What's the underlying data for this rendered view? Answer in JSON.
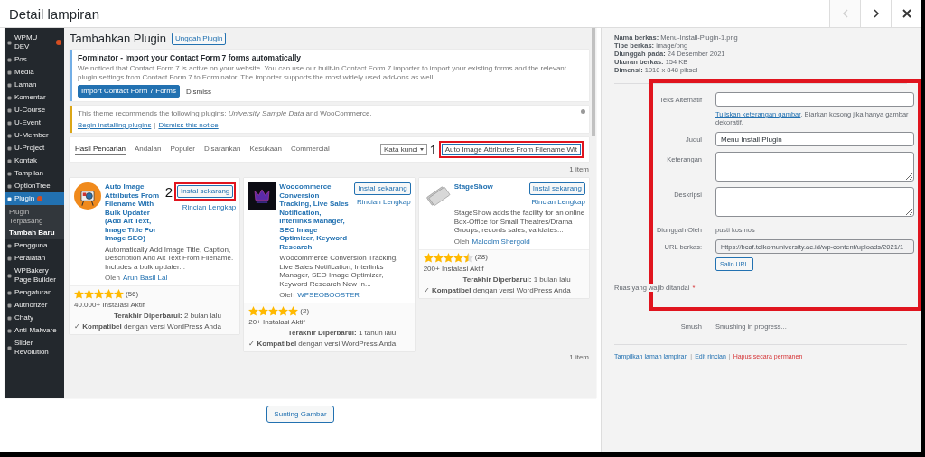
{
  "modal": {
    "title": "Detail lampiran",
    "nav": [
      {
        "kind": "prev",
        "disabled": true
      },
      {
        "kind": "next",
        "disabled": false
      },
      {
        "kind": "close",
        "disabled": false
      }
    ]
  },
  "preview": {
    "sidebar": [
      {
        "label": "WPMU DEV",
        "selected": false,
        "badge": true
      },
      {
        "label": "Pos",
        "selected": false
      },
      {
        "label": "Media",
        "selected": false
      },
      {
        "label": "Laman",
        "selected": false
      },
      {
        "label": "Komentar",
        "selected": false
      },
      {
        "label": "U-Course",
        "selected": false
      },
      {
        "label": "U-Event",
        "selected": false
      },
      {
        "label": "U-Member",
        "selected": false
      },
      {
        "label": "U-Project",
        "selected": false
      },
      {
        "label": "Kontak",
        "selected": false
      },
      {
        "label": "Tampilan",
        "selected": false
      },
      {
        "label": "OptionTree",
        "selected": false
      },
      {
        "label": "Plugin",
        "selected": true,
        "badge": true,
        "children": [
          {
            "label": "Plugin Terpasang",
            "selected": false
          },
          {
            "label": "Tambah Baru",
            "selected": true
          }
        ]
      },
      {
        "label": "Pengguna",
        "selected": false
      },
      {
        "label": "Peralatan",
        "selected": false
      },
      {
        "label": "WPBakery Page Builder",
        "selected": false
      },
      {
        "label": "Pengaturan",
        "selected": false
      },
      {
        "label": "Authorizer",
        "selected": false
      },
      {
        "label": "Chaty",
        "selected": false
      },
      {
        "label": "Anti-Malware",
        "selected": false
      },
      {
        "label": "Slider Revolution",
        "selected": false
      }
    ],
    "heading": "Tambahkan Plugin",
    "upload_button": "Unggah Plugin",
    "notices": [
      {
        "kind": "info",
        "title": "Forminator - Import your Contact Form 7 forms automatically",
        "text": "We noticed that Contact Form 7 is active on your website. You can use our built-in Contact Form 7 importer to import your existing forms and the relevant plugin settings from Contact Form 7 to Forminator. The importer supports the most widely used add-ons as well.",
        "button": "Import Contact Form 7 Forms",
        "dismiss": "Dismiss"
      },
      {
        "kind": "warning",
        "text": "This theme recommends the following plugins: *University Sample Data* and WooCommerce.",
        "links": [
          "Begin installing plugins",
          "Dismiss this notice"
        ],
        "separator": "|"
      }
    ],
    "tabs": [
      {
        "label": "Hasil Pencarian",
        "selected": true
      },
      {
        "label": "Andalan",
        "selected": false
      },
      {
        "label": "Populer",
        "selected": false
      },
      {
        "label": "Disarankan",
        "selected": false
      },
      {
        "label": "Kesukaan",
        "selected": false
      },
      {
        "label": "Commercial",
        "selected": false
      }
    ],
    "search": {
      "select": "Kata kunci",
      "value": "Auto Image Attributes From Filename Wit",
      "annotation": "1"
    },
    "result_count": "1 item",
    "cards": [
      {
        "kind": "camera",
        "title": "Auto Image Attributes From Filename With Bulk Updater (Add Alt Text, Image Title For Image SEO)",
        "description": "Automatically Add Image Title, Caption, Description And Alt Text From Filename. Includes a bulk updater...",
        "by": "Oleh",
        "author": "Arun Basil Lal",
        "install": "Instal sekarang",
        "details": "Rincian Lengkap",
        "annotation": "2",
        "stars": 5,
        "ratings": "(56)",
        "installs": "40.000+ Instalasi Aktif",
        "updated": "**Terakhir Diperbarui:** 2 bulan lalu",
        "compatible": "✓ **Kompatibel** dengan versi WordPress Anda"
      },
      {
        "kind": "crown",
        "title": "Woocommerce Conversion Tracking, Live Sales Notification, Interlinks Manager, SEO Image Optimizer, Keyword Research",
        "description": "Woocommerce Conversion Tracking, Live Sales Notification, Interlinks Manager, SEO Image Optimizer, Keyword Research New In...",
        "by": "Oleh",
        "author": "WPSEOBOOSTER",
        "install": "Instal sekarang",
        "details": "Rincian Lengkap",
        "stars": 5,
        "ratings": "(2)",
        "installs": "20+ Instalasi Aktif",
        "updated": "**Terakhir Diperbarui:** 1 tahun lalu",
        "compatible": "✓ **Kompatibel** dengan versi WordPress Anda"
      },
      {
        "kind": "tickets",
        "title": "StageShow",
        "description": "StageShow adds the facility for an online Box-Office for Small Theatres/Drama Groups, records sales, validates...",
        "by": "Oleh",
        "author": "Malcolm Shergold",
        "install": "Instal sekarang",
        "details": "Rincian Lengkap",
        "stars": 4.5,
        "ratings": "(28)",
        "installs": "200+ Instalasi Aktif",
        "updated": "**Terakhir Diperbarui:** 1 bulan lalu",
        "compatible": "✓ **Kompatibel** dengan versi WordPress Anda"
      }
    ],
    "result_count_bottom": "1 item"
  },
  "edit_image_button": "Sunting Gambar",
  "details": [
    "**Nama berkas:** Menu-Install-Plugin-1.png",
    "**Tipe berkas:** image/png",
    "**Diunggah pada:** 24 Desember 2021",
    "**Ukuran berkas:** 154 KB",
    "**Dimensi:** 1910 x 848 piksel"
  ],
  "form": {
    "highlight": true,
    "fields": [
      {
        "kind": "input",
        "label": "Teks Alternatif"
      },
      {
        "kind": "help",
        "link": "Tuliskan keterangan gambar",
        "text": ". Biarkan kosong jika hanya gambar dekoratif."
      },
      {
        "kind": "input",
        "label": "Judul",
        "value": "Menu Install Plugin"
      },
      {
        "kind": "textarea",
        "label": "Keterangan"
      },
      {
        "kind": "textarea",
        "label": "Deskripsi"
      },
      {
        "kind": "text",
        "label": "Diunggah Oleh",
        "value": "pusti kosmos"
      },
      {
        "kind": "readonly",
        "label": "URL berkas:",
        "value": "https://bcaf.telkomuniversity.ac.id/wp-content/uploads/2021/1"
      },
      {
        "kind": "button",
        "label": "Salin URL"
      }
    ]
  },
  "required_note": {
    "text": "Ruas yang wajib ditandai",
    "mark": "*"
  },
  "smush": {
    "label": "Smush",
    "value": "Smushing in progress..."
  },
  "actions": {
    "separator": "|",
    "items": [
      {
        "label": "Tampilkan laman lampiran",
        "kind": "link"
      },
      {
        "label": "Edit rincian",
        "kind": "link"
      },
      {
        "label": "Hapus secara permanen",
        "kind": "danger"
      }
    ]
  }
}
